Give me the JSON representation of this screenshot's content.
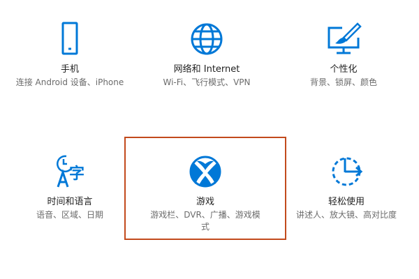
{
  "accent_color": "#0078d7",
  "highlight_color": "#c24a1c",
  "tiles": [
    {
      "icon": "phone-icon",
      "title": "手机",
      "desc": "连接 Android 设备、iPhone"
    },
    {
      "icon": "globe-icon",
      "title": "网络和 Internet",
      "desc": "Wi-Fi、飞行模式、VPN"
    },
    {
      "icon": "paint-monitor-icon",
      "title": "个性化",
      "desc": "背景、锁屏、颜色"
    },
    {
      "icon": "time-language-icon",
      "title": "时间和语言",
      "desc": "语音、区域、日期"
    },
    {
      "icon": "xbox-icon",
      "title": "游戏",
      "desc": "游戏栏、DVR、广播、游戏模式"
    },
    {
      "icon": "ease-of-access-icon",
      "title": "轻松使用",
      "desc": "讲述人、放大镜、高对比度"
    }
  ]
}
